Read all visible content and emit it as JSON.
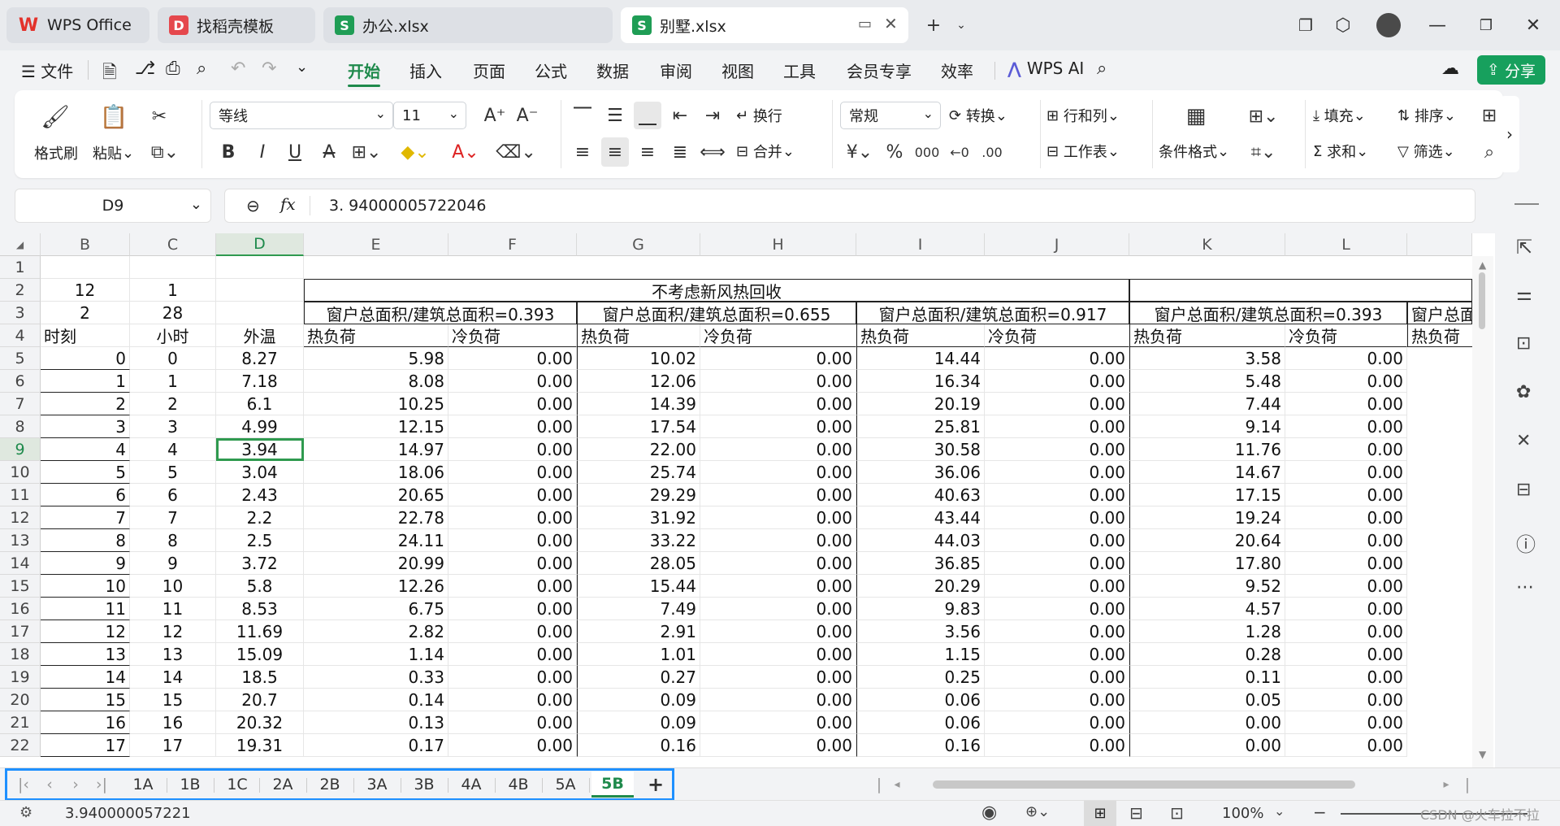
{
  "tabs": [
    {
      "label": "WPS Office",
      "icon": "wps-logo-icon"
    },
    {
      "label": "找稻壳模板",
      "icon": "docer-icon"
    },
    {
      "label": "办公.xlsx",
      "icon": "spreadsheet-icon"
    },
    {
      "label": "别墅.xlsx",
      "icon": "spreadsheet-icon",
      "active": true
    }
  ],
  "menu": {
    "file": "文件",
    "items": [
      "开始",
      "插入",
      "页面",
      "公式",
      "数据",
      "审阅",
      "视图",
      "工具",
      "会员专享",
      "效率"
    ],
    "ai": "WPS AI",
    "share": "分享"
  },
  "ribbon": {
    "format_painter": "格式刷",
    "paste": "粘贴",
    "font": "等线",
    "size": "11",
    "wrap": "换行",
    "merge": "合并",
    "number_format": "常规",
    "convert": "转换",
    "rowcol": "行和列",
    "sheet": "工作表",
    "cond_format": "条件格式",
    "fill": "填充",
    "sort": "排序",
    "sum": "求和",
    "filter": "筛选"
  },
  "formula_bar": {
    "cell_ref": "D9",
    "fx": "fx",
    "value": "3. 94000005722046"
  },
  "columns": [
    "B",
    "C",
    "D",
    "E",
    "F",
    "G",
    "H",
    "I",
    "J",
    "K",
    "L"
  ],
  "rows": [
    {
      "n": "1",
      "B": "",
      "C": "",
      "D": "",
      "E": "",
      "F": "",
      "G": "",
      "H": "",
      "I": "",
      "J": "",
      "K": "",
      "L": ""
    },
    {
      "n": "2",
      "B": "12",
      "C": "1",
      "D": ""
    },
    {
      "n": "3",
      "B": "2",
      "C": "28",
      "D": ""
    },
    {
      "n": "4",
      "B": "时刻",
      "C": "小时",
      "D": "外温",
      "E": "热负荷",
      "F": "冷负荷",
      "G": "热负荷",
      "H": "冷负荷",
      "I": "热负荷",
      "J": "冷负荷",
      "K": "热负荷",
      "L": "冷负荷",
      "M": "热负荷"
    },
    {
      "n": "5",
      "B": "0",
      "C": "0",
      "D": "8.27",
      "E": "5.98",
      "F": "0.00",
      "G": "10.02",
      "H": "0.00",
      "I": "14.44",
      "J": "0.00",
      "K": "3.58",
      "L": "0.00"
    },
    {
      "n": "6",
      "B": "1",
      "C": "1",
      "D": "7.18",
      "E": "8.08",
      "F": "0.00",
      "G": "12.06",
      "H": "0.00",
      "I": "16.34",
      "J": "0.00",
      "K": "5.48",
      "L": "0.00"
    },
    {
      "n": "7",
      "B": "2",
      "C": "2",
      "D": "6.1",
      "E": "10.25",
      "F": "0.00",
      "G": "14.39",
      "H": "0.00",
      "I": "20.19",
      "J": "0.00",
      "K": "7.44",
      "L": "0.00"
    },
    {
      "n": "8",
      "B": "3",
      "C": "3",
      "D": "4.99",
      "E": "12.15",
      "F": "0.00",
      "G": "17.54",
      "H": "0.00",
      "I": "25.81",
      "J": "0.00",
      "K": "9.14",
      "L": "0.00"
    },
    {
      "n": "9",
      "B": "4",
      "C": "4",
      "D": "3.94",
      "E": "14.97",
      "F": "0.00",
      "G": "22.00",
      "H": "0.00",
      "I": "30.58",
      "J": "0.00",
      "K": "11.76",
      "L": "0.00"
    },
    {
      "n": "10",
      "B": "5",
      "C": "5",
      "D": "3.04",
      "E": "18.06",
      "F": "0.00",
      "G": "25.74",
      "H": "0.00",
      "I": "36.06",
      "J": "0.00",
      "K": "14.67",
      "L": "0.00"
    },
    {
      "n": "11",
      "B": "6",
      "C": "6",
      "D": "2.43",
      "E": "20.65",
      "F": "0.00",
      "G": "29.29",
      "H": "0.00",
      "I": "40.63",
      "J": "0.00",
      "K": "17.15",
      "L": "0.00"
    },
    {
      "n": "12",
      "B": "7",
      "C": "7",
      "D": "2.2",
      "E": "22.78",
      "F": "0.00",
      "G": "31.92",
      "H": "0.00",
      "I": "43.44",
      "J": "0.00",
      "K": "19.24",
      "L": "0.00"
    },
    {
      "n": "13",
      "B": "8",
      "C": "8",
      "D": "2.5",
      "E": "24.11",
      "F": "0.00",
      "G": "33.22",
      "H": "0.00",
      "I": "44.03",
      "J": "0.00",
      "K": "20.64",
      "L": "0.00"
    },
    {
      "n": "14",
      "B": "9",
      "C": "9",
      "D": "3.72",
      "E": "20.99",
      "F": "0.00",
      "G": "28.05",
      "H": "0.00",
      "I": "36.85",
      "J": "0.00",
      "K": "17.80",
      "L": "0.00"
    },
    {
      "n": "15",
      "B": "10",
      "C": "10",
      "D": "5.8",
      "E": "12.26",
      "F": "0.00",
      "G": "15.44",
      "H": "0.00",
      "I": "20.29",
      "J": "0.00",
      "K": "9.52",
      "L": "0.00"
    },
    {
      "n": "16",
      "B": "11",
      "C": "11",
      "D": "8.53",
      "E": "6.75",
      "F": "0.00",
      "G": "7.49",
      "H": "0.00",
      "I": "9.83",
      "J": "0.00",
      "K": "4.57",
      "L": "0.00"
    },
    {
      "n": "17",
      "B": "12",
      "C": "12",
      "D": "11.69",
      "E": "2.82",
      "F": "0.00",
      "G": "2.91",
      "H": "0.00",
      "I": "3.56",
      "J": "0.00",
      "K": "1.28",
      "L": "0.00"
    },
    {
      "n": "18",
      "B": "13",
      "C": "13",
      "D": "15.09",
      "E": "1.14",
      "F": "0.00",
      "G": "1.01",
      "H": "0.00",
      "I": "1.15",
      "J": "0.00",
      "K": "0.28",
      "L": "0.00"
    },
    {
      "n": "19",
      "B": "14",
      "C": "14",
      "D": "18.5",
      "E": "0.33",
      "F": "0.00",
      "G": "0.27",
      "H": "0.00",
      "I": "0.25",
      "J": "0.00",
      "K": "0.11",
      "L": "0.00"
    },
    {
      "n": "20",
      "B": "15",
      "C": "15",
      "D": "20.7",
      "E": "0.14",
      "F": "0.00",
      "G": "0.09",
      "H": "0.00",
      "I": "0.06",
      "J": "0.00",
      "K": "0.05",
      "L": "0.00"
    },
    {
      "n": "21",
      "B": "16",
      "C": "16",
      "D": "20.32",
      "E": "0.13",
      "F": "0.00",
      "G": "0.09",
      "H": "0.00",
      "I": "0.06",
      "J": "0.00",
      "K": "0.00",
      "L": "0.00"
    },
    {
      "n": "22",
      "B": "17",
      "C": "17",
      "D": "19.31",
      "E": "0.17",
      "F": "0.00",
      "G": "0.16",
      "H": "0.00",
      "I": "0.16",
      "J": "0.00",
      "K": "0.00",
      "L": "0.00"
    }
  ],
  "headers": {
    "main": "不考虑新风热回收",
    "ratio_1": "窗户总面积/建筑总面积=0.393",
    "ratio_2": "窗户总面积/建筑总面积=0.655",
    "ratio_3": "窗户总面积/建筑总面积=0.917",
    "ratio_4": "窗户总面积/建筑总面积=0.393",
    "ratio_5": "窗户总面"
  },
  "sheet_tabs": [
    "1A",
    "1B",
    "1C",
    "2A",
    "2B",
    "3A",
    "3B",
    "4A",
    "4B",
    "5A",
    "5B"
  ],
  "active_sheet": "5B",
  "status": {
    "value": "3.940000057221",
    "zoom": "100%",
    "watermark": "CSDN @火车拉不拉"
  },
  "colors": {
    "accent": "#1f8a4c",
    "share_button": "#17a05d",
    "selection": "#2f9a4f",
    "highlight_box": "#1e90ff"
  }
}
